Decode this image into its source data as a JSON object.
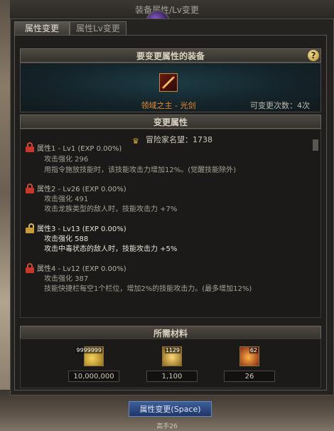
{
  "window": {
    "title": "装备属性/Lv变更"
  },
  "tabs": [
    {
      "label": "属性变更",
      "active": true
    },
    {
      "label": "属性Lv变更",
      "active": false
    }
  ],
  "equipment_section": {
    "header": "要变更属性的装备",
    "help_glyph": "?",
    "item_name": "领域之主 - 光剑",
    "changes_left": "可变更次数：4次"
  },
  "attributes_section": {
    "header": "变更属性",
    "fame": "冒险家名望：1738",
    "attributes": [
      {
        "title": "属性1 - Lv1 (EXP 0.00%)",
        "stat": "攻击强化 296",
        "effect": "用指令施放技能时，该技能攻击力增加12%。(觉醒技能除外)",
        "locked": true
      },
      {
        "title": "属性2 - Lv26 (EXP 0.00%)",
        "stat": "攻击强化 491",
        "effect": "攻击龙族类型的敌人时，技能攻击力 +7%",
        "locked": true
      },
      {
        "title": "属性3 - Lv13 (EXP 0.00%)",
        "stat": "攻击强化 588",
        "effect": "攻击中毒状态的敌人时，技能攻击力 +5%",
        "locked": false
      },
      {
        "title": "属性4 - Lv12 (EXP 0.00%)",
        "stat": "攻击强化 387",
        "effect": "技能快捷栏每空1个栏位，增加2%的技能攻击力。(最多增加12%)",
        "locked": true
      }
    ]
  },
  "materials_section": {
    "header": "所需材料",
    "materials": [
      {
        "icon": "gold-coins-icon",
        "badge": "9999999",
        "value": "10,000,000"
      },
      {
        "icon": "gem-icon",
        "badge": "1129",
        "value": "1,100"
      },
      {
        "icon": "fire-crystal-icon",
        "badge": "62",
        "value": "26"
      }
    ]
  },
  "action_button": "属性变更(Space)",
  "footer_text": "高手26",
  "colors": {
    "item_name": "#f08a2a",
    "lock": "#c7382a",
    "button": "#2e4b86"
  }
}
